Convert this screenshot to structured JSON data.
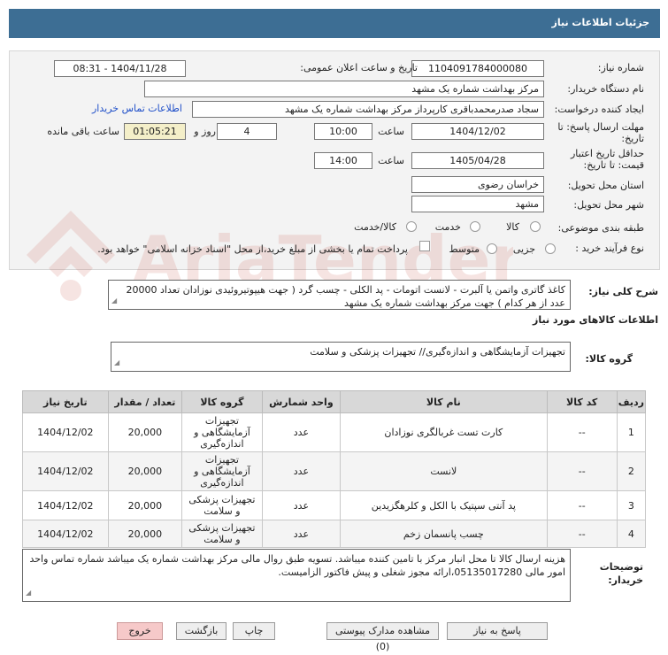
{
  "header": {
    "title": "جزئیات اطلاعات نیاز"
  },
  "form": {
    "need_number_label": "شماره نیاز:",
    "need_number": "1104091784000080",
    "announce_label": "تاریخ و ساعت اعلان عمومی:",
    "announce_value": "1404/11/28 - 08:31",
    "buyer_label": "نام دستگاه خریدار:",
    "buyer_value": "مرکز بهداشت شماره یک مشهد",
    "creator_label": "ایجاد کننده درخواست:",
    "creator_value": "سجاد صدرمحمدباقری کارپرداز مرکز بهداشت شماره یک مشهد",
    "contact_link": "اطلاعات تماس خریدار",
    "deadline_label": "مهلت ارسال پاسخ: تا تاریخ:",
    "deadline_date": "1404/12/02",
    "time_label": "ساعت",
    "deadline_time": "10:00",
    "days_value": "4",
    "days_label": "روز و",
    "remaining_value": "01:05:21",
    "remaining_label": "ساعت باقی مانده",
    "validity_label": "حداقل تاریخ اعتبار قیمت: تا تاریخ:",
    "validity_date": "1405/04/28",
    "validity_time": "14:00",
    "province_label": "استان محل تحویل:",
    "province_value": "خراسان رضوی",
    "city_label": "شهر محل تحویل:",
    "city_value": "مشهد",
    "category_label": "طبقه بندی موضوعی:",
    "category_options": [
      "کالا",
      "خدمت",
      "کالا/خدمت"
    ],
    "process_label": "نوع فرآیند خرید :",
    "process_options": [
      "جزیی",
      "متوسط"
    ],
    "payment_note": "پرداخت تمام یا بخشی از مبلغ خرید،از محل \"اسناد خزانه اسلامی\" خواهد بود."
  },
  "summary": {
    "label": "شرح کلی نیاز:",
    "text": "کاغذ گاتری واتمن یا آلبرت - لانست اتومات - پد الکلی - چسب گرد ( جهت هیپوتیروئیدی نوزادان تعداد 20000 عدد از هر کدام ) جهت مرکز بهداشت شماره یک مشهد"
  },
  "goods": {
    "section_title": "اطلاعات کالاهای مورد نیاز",
    "group_label": "گروه کالا:",
    "group_value": "تجهیزات آزمایشگاهی و اندازه‌گیری// تجهیزات پزشکی و سلامت"
  },
  "table": {
    "headers": [
      "ردیف",
      "کد کالا",
      "نام کالا",
      "واحد شمارش",
      "گروه کالا",
      "تعداد / مقدار",
      "تاریخ نیاز"
    ],
    "rows": [
      [
        "1",
        "--",
        "کارت تست غربالگری نوزادان",
        "عدد",
        "تجهیزات آزمایشگاهی و اندازه‌گیری",
        "20,000",
        "1404/12/02"
      ],
      [
        "2",
        "--",
        "لانست",
        "عدد",
        "تجهیزات آزمایشگاهی و اندازه‌گیری",
        "20,000",
        "1404/12/02"
      ],
      [
        "3",
        "--",
        "پد آنتی سپتیک با الکل و کلرهگزیدین",
        "عدد",
        "تجهیزات پزشکی و سلامت",
        "20,000",
        "1404/12/02"
      ],
      [
        "4",
        "--",
        "چسب پانسمان زخم",
        "عدد",
        "تجهیزات پزشکی و سلامت",
        "20,000",
        "1404/12/02"
      ]
    ]
  },
  "notes": {
    "label": "توضیحات خریدار:",
    "text": "هزینه ارسال کالا تا محل انبار مرکز با تامین کننده میباشد. تسویه طبق روال مالی مرکز بهداشت شماره یک میباشد شماره تماس واحد امور مالی 05135017280،ارائه مجوز شغلی و پیش فاکتور الزامیست."
  },
  "buttons": {
    "reply": "پاسخ به نیاز",
    "attachments": "مشاهده مدارک پیوستی (0)",
    "print": "چاپ",
    "back": "بازگشت",
    "exit": "خروج"
  },
  "watermark": {
    "text": "AriaTender.net"
  },
  "colors": {
    "header": "#3d6e94",
    "highlight": "#f4efc9",
    "link": "#1f4fc9",
    "exit_button": "#f6c9c9"
  }
}
